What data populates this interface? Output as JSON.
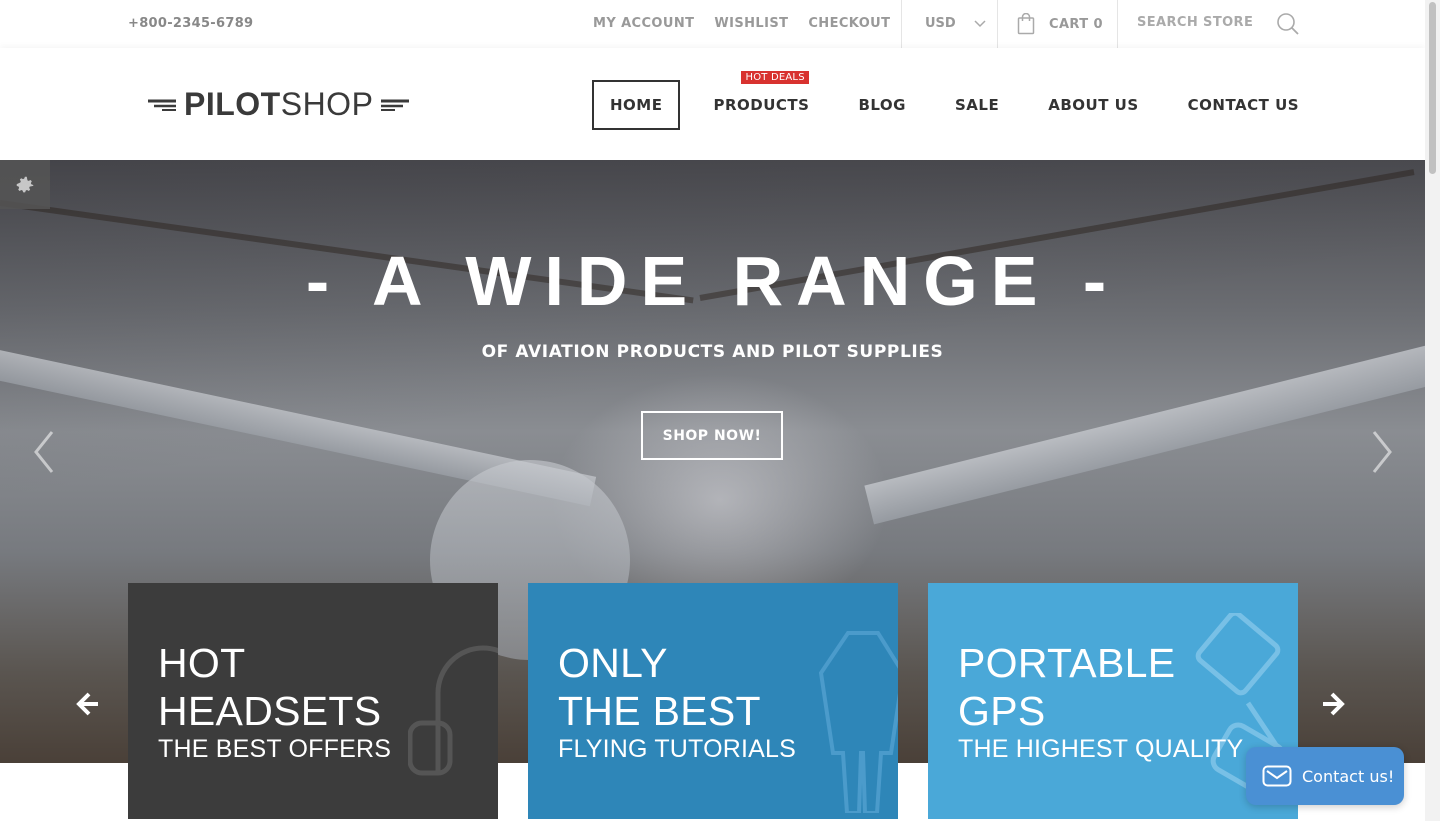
{
  "topbar": {
    "phone": "+800-2345-6789",
    "links": [
      "MY ACCOUNT",
      "WISHLIST",
      "CHECKOUT"
    ],
    "currency": "USD",
    "cart_label": "CART",
    "cart_count": "0",
    "search_placeholder": "SEARCH STORE"
  },
  "header": {
    "logo_bold": "PILOT",
    "logo_light": "SHOP",
    "nav": [
      {
        "label": "HOME",
        "active": true
      },
      {
        "label": "PRODUCTS",
        "badge": "HOT DEALS"
      },
      {
        "label": "BLOG"
      },
      {
        "label": "SALE"
      },
      {
        "label": "ABOUT US"
      },
      {
        "label": "CONTACT US"
      }
    ]
  },
  "hero": {
    "title": "- A WIDE RANGE -",
    "subtitle": "OF AVIATION PRODUCTS AND PILOT SUPPLIES",
    "button": "SHOP NOW!"
  },
  "promos": [
    {
      "line1": "HOT",
      "line2": "HEADSETS",
      "sub": "THE BEST OFFERS",
      "color": "#3c3c3c",
      "icon": "headset-icon"
    },
    {
      "line1": "ONLY",
      "line2": "THE BEST",
      "sub": "FLYING TUTORIALS",
      "color": "#2e86b8",
      "icon": "flight-suit-icon"
    },
    {
      "line1": "PORTABLE",
      "line2": "GPS",
      "sub": "THE HIGHEST QUALITY",
      "color": "#4aa8d8",
      "icon": "gps-icon"
    }
  ],
  "contact": {
    "label": "Contact us!"
  },
  "colors": {
    "badge": "#d8322f",
    "contact": "#4a90d4"
  }
}
